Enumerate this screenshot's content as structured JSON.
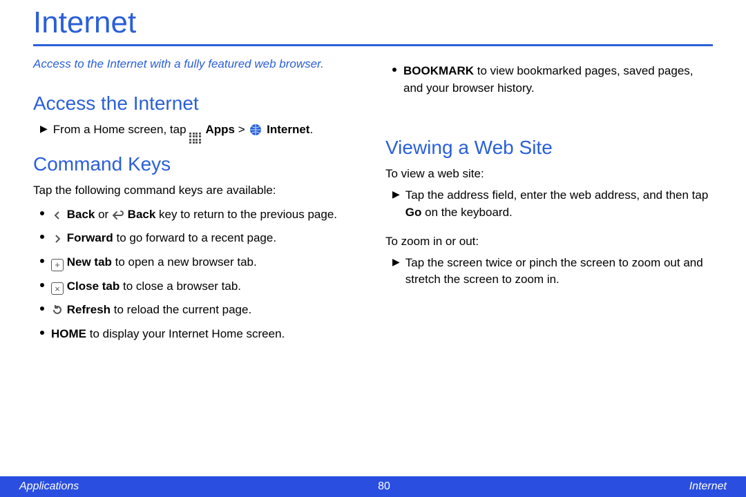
{
  "title": "Internet",
  "intro": "Access to the Internet with a fully featured web browser.",
  "sections": {
    "access": {
      "heading": "Access the Internet",
      "line_prefix": "From a Home screen, tap ",
      "apps_label": "Apps",
      "sep": " > ",
      "internet_label": "Internet",
      "period": "."
    },
    "command": {
      "heading": "Command Keys",
      "lead": "Tap the following command keys are available:",
      "items": [
        {
          "icon": "back",
          "bold1": "Back",
          "mid": " or ",
          "icon2": "back-arrow",
          "bold2": "Back",
          "tail": " key to return to the previous page."
        },
        {
          "icon": "forward",
          "bold1": "Forward",
          "tail": " to go forward to a recent page."
        },
        {
          "icon": "plus",
          "bold1": "New tab",
          "tail": " to open a new browser tab."
        },
        {
          "icon": "close",
          "bold1": "Close tab",
          "tail": " to close a browser tab."
        },
        {
          "icon": "refresh",
          "bold1": "Refresh",
          "tail": " to reload the current page."
        },
        {
          "bold1": "HOME",
          "tail": " to display your Internet Home screen."
        }
      ]
    },
    "bookmark": {
      "bold1": "BOOKMARK",
      "tail": " to view bookmarked pages, saved pages, and your browser history."
    },
    "viewing": {
      "heading": "Viewing a Web Site",
      "p1": "To view a web site:",
      "step1_a": "Tap the address field, enter the web address, and then tap ",
      "step1_bold": "Go",
      "step1_b": " on the keyboard.",
      "p2": "To zoom in or out:",
      "step2": "Tap the screen twice or pinch the screen to zoom out and stretch the screen to zoom in."
    }
  },
  "footer": {
    "left": "Applications",
    "page": "80",
    "right": "Internet"
  }
}
